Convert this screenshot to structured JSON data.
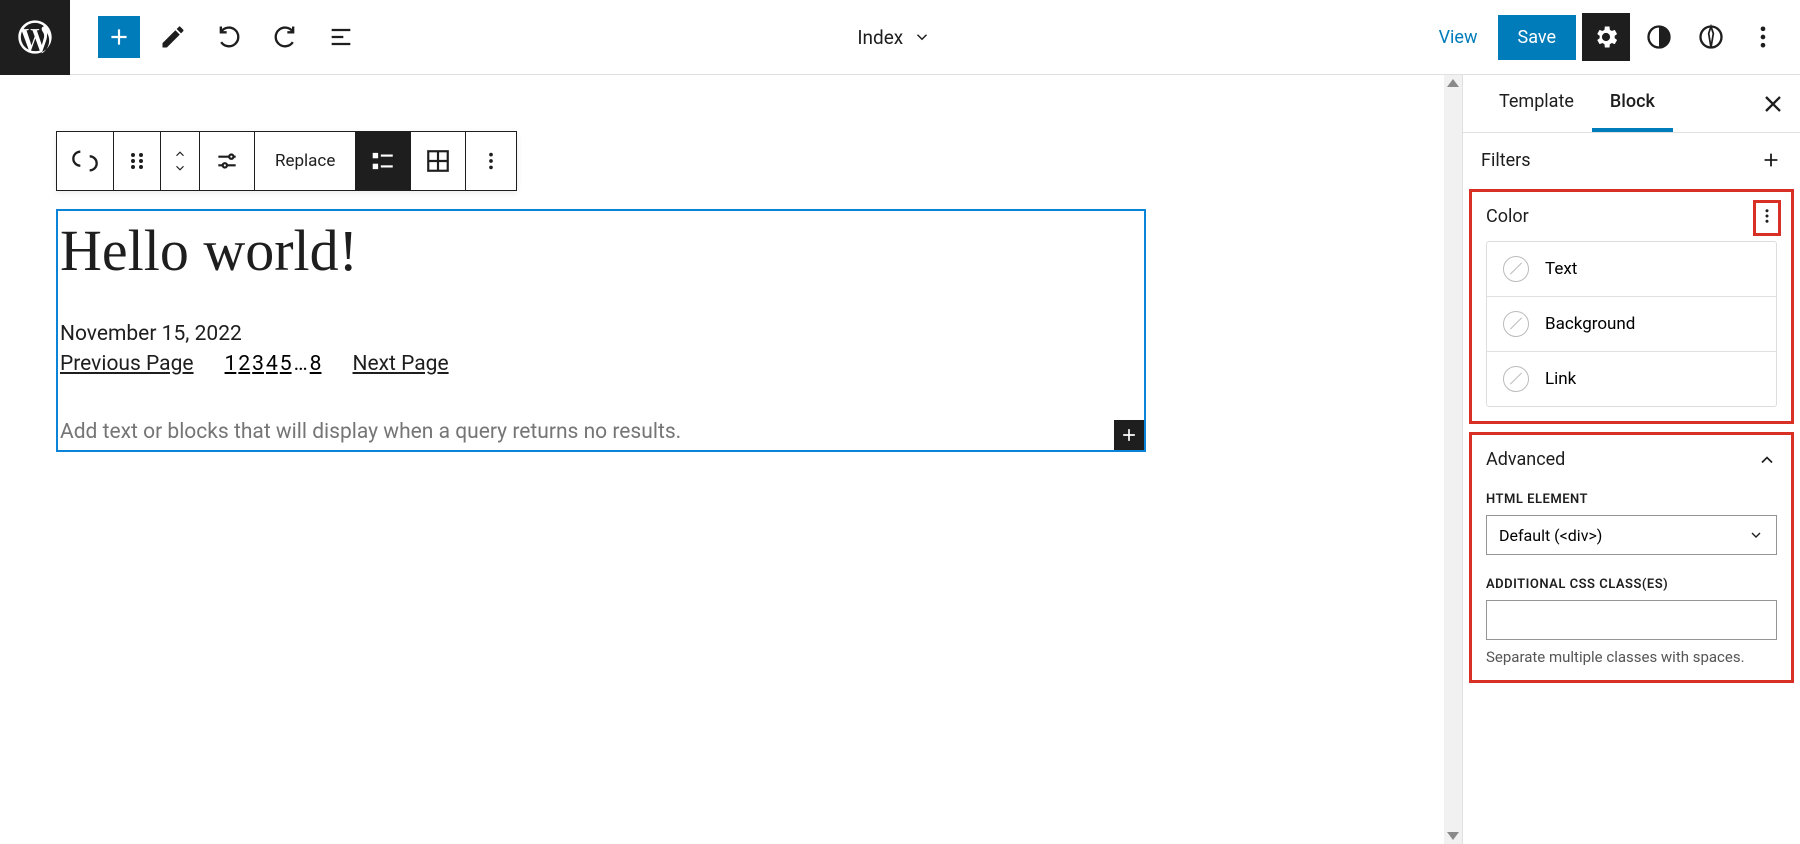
{
  "toolbar": {
    "doc_title": "Index",
    "view": "View",
    "save": "Save",
    "replace": "Replace"
  },
  "editor": {
    "post_title": "Hello world!",
    "post_date": "November 15, 2022",
    "prev_page": "Previous Page",
    "next_page": "Next Page",
    "pages": [
      "1",
      "2",
      "3",
      "4",
      "5",
      "…",
      "8"
    ],
    "no_results_placeholder": "Add text or blocks that will display when a query returns no results."
  },
  "sidebar": {
    "tabs": {
      "template": "Template",
      "block": "Block"
    },
    "filters": "Filters",
    "color": {
      "title": "Color",
      "text": "Text",
      "background": "Background",
      "link": "Link"
    },
    "advanced": {
      "title": "Advanced",
      "html_element_label": "HTML ELEMENT",
      "html_element_value": "Default (<div>)",
      "css_label": "ADDITIONAL CSS CLASS(ES)",
      "css_hint": "Separate multiple classes with spaces."
    }
  }
}
